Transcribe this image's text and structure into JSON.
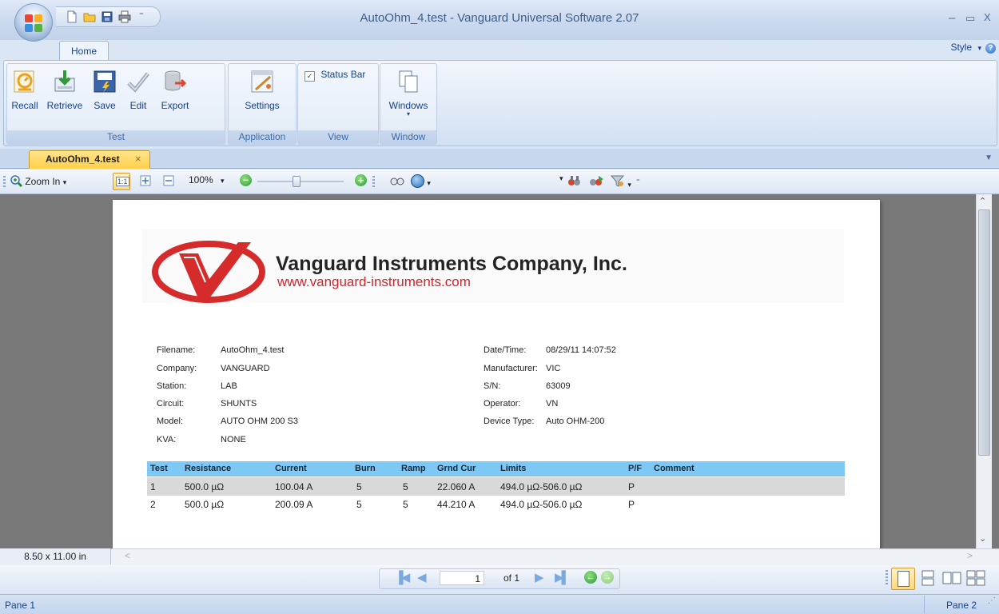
{
  "window": {
    "title": "AutoOhm_4.test - Vanguard Universal Software 2.07",
    "minimize_glyph": "–",
    "maximize_glyph": "▭",
    "close_glyph": "X"
  },
  "ribbon": {
    "tabs": [
      {
        "label": "Home"
      }
    ],
    "style_label": "Style",
    "help_glyph": "?",
    "groups": {
      "test": {
        "label": "Test",
        "buttons": [
          {
            "label": "Recall",
            "icon": "recall-icon"
          },
          {
            "label": "Retrieve",
            "icon": "retrieve-icon"
          },
          {
            "label": "Save",
            "icon": "save-icon"
          },
          {
            "label": "Edit",
            "icon": "edit-icon"
          },
          {
            "label": "Export",
            "icon": "export-icon"
          }
        ]
      },
      "application": {
        "label": "Application",
        "buttons": [
          {
            "label": "Settings",
            "icon": "settings-icon"
          }
        ]
      },
      "view": {
        "label": "View",
        "status_bar_label": "Status Bar",
        "status_bar_checked": true
      },
      "window": {
        "label": "Window",
        "buttons": [
          {
            "label": "Windows",
            "icon": "windows-icon"
          }
        ]
      }
    }
  },
  "document_tab": {
    "label": "AutoOhm_4.test",
    "close_glyph": "×"
  },
  "preview_toolbar": {
    "zoom_label": "Zoom In",
    "zoom_percent": "100%",
    "zoom_slider_level": 0.45
  },
  "report": {
    "company_name": "Vanguard Instruments Company, Inc.",
    "company_url": "www.vanguard-instruments.com",
    "left_fields": [
      {
        "label": "Filename:",
        "value": "AutoOhm_4.test"
      },
      {
        "label": "Company:",
        "value": "VANGUARD"
      },
      {
        "label": "Station:",
        "value": "LAB"
      },
      {
        "label": "Circuit:",
        "value": "SHUNTS"
      },
      {
        "label": "Model:",
        "value": "AUTO OHM 200 S3"
      },
      {
        "label": "KVA:",
        "value": "NONE"
      }
    ],
    "right_fields": [
      {
        "label": "Date/Time:",
        "value": "08/29/11 14:07:52"
      },
      {
        "label": "Manufacturer:",
        "value": "VIC"
      },
      {
        "label": "S/N:",
        "value": "63009"
      },
      {
        "label": "Operator:",
        "value": "VN"
      },
      {
        "label": "Device Type:",
        "value": "Auto OHM-200"
      }
    ],
    "table": {
      "columns": [
        "Test",
        "Resistance",
        "Current",
        "Burn",
        "Ramp",
        "Grnd Cur",
        "Limits",
        "P/F",
        "Comment"
      ],
      "rows": [
        [
          "1",
          "500.0 µΩ",
          "100.04 A",
          "5",
          "5",
          "22.060 A",
          "494.0 µΩ-506.0 µΩ",
          "P",
          ""
        ],
        [
          "2",
          "500.0 µΩ",
          "200.09 A",
          "5",
          "5",
          "44.210 A",
          "494.0 µΩ-506.0 µΩ",
          "P",
          ""
        ]
      ]
    }
  },
  "page_size": "8.50 x 11.00 in",
  "navigation": {
    "current_page": "1",
    "of_label": "of 1"
  },
  "status_bar": {
    "left": "Pane 1",
    "right": "Pane 2"
  }
}
